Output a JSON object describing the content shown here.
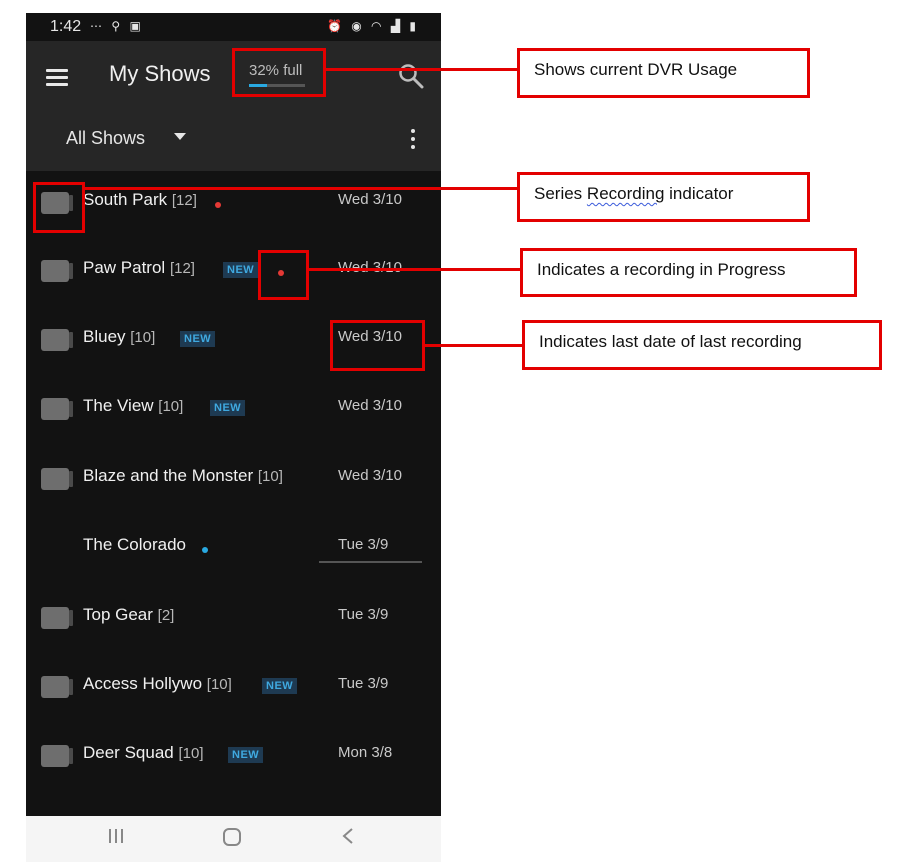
{
  "status_bar": {
    "time": "1:42"
  },
  "app_bar": {
    "title": "My Shows",
    "usage_text": "32% full",
    "usage_fraction": 0.32
  },
  "filter": {
    "selected": "All Shows"
  },
  "shows": [
    {
      "name": "South Park",
      "count": "[12]",
      "date": "Wed 3/10",
      "new": false,
      "dot": "red",
      "series": true
    },
    {
      "name": "Paw Patrol",
      "count": "[12]",
      "date": "Wed 3/10",
      "new": true,
      "dot": "red",
      "series": true
    },
    {
      "name": "Bluey",
      "count": "[10]",
      "date": "Wed 3/10",
      "new": true,
      "series": true
    },
    {
      "name": "The View",
      "count": "[10]",
      "date": "Wed 3/10",
      "new": true,
      "series": true
    },
    {
      "name": "Blaze and the Monster",
      "count": "[10]",
      "date": "Wed 3/10",
      "new": false,
      "series": true
    },
    {
      "name": "The Colorado",
      "count": "",
      "date": "Tue  3/9",
      "new": false,
      "dot": "blue",
      "series": false
    },
    {
      "name": "Top Gear",
      "count": "[2]",
      "date": "Tue  3/9",
      "new": false,
      "series": true
    },
    {
      "name": "Access Hollywo",
      "count": "[10]",
      "date": "Tue  3/9",
      "new": true,
      "series": true
    },
    {
      "name": "Deer Squad",
      "count": "[10]",
      "date": "Mon 3/8",
      "new": true,
      "series": true
    }
  ],
  "badge_new_label": "NEW",
  "annotations": {
    "dvr_usage": "Shows current DVR Usage",
    "series_prefix": "Series ",
    "series_word": "Recording",
    "series_suffix": " indicator",
    "in_progress": "Indicates a recording in Progress",
    "last_date": "Indicates last date of last recording"
  },
  "colors": {
    "annotation_red": "#e30000",
    "recording_dot": "#e53935",
    "info_dot": "#29a9e1",
    "accent_blue": "#29a9e1",
    "background": "#121212",
    "app_bar": "#262626"
  },
  "icons": {
    "menu": "menu-icon",
    "search": "search-icon",
    "more": "kebab-icon",
    "series": "series-recording-icon",
    "nav_recents": "recents-icon",
    "nav_home": "home-icon",
    "nav_back": "back-icon"
  }
}
